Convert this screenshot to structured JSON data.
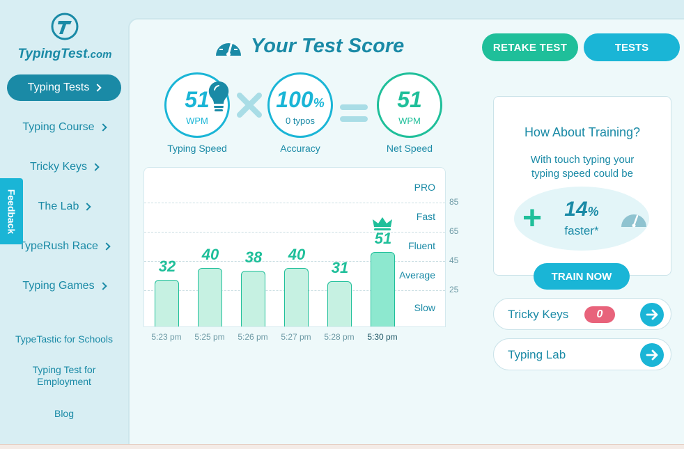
{
  "brand": {
    "name": "TypingTest",
    "suffix": ".com"
  },
  "sidebar": {
    "items": [
      {
        "label": "Typing Tests",
        "active": true
      },
      {
        "label": "Typing Course"
      },
      {
        "label": "Tricky Keys"
      },
      {
        "label": "The Lab"
      },
      {
        "label": "TypeRush Race"
      },
      {
        "label": "Typing Games"
      }
    ],
    "small_links": [
      {
        "label": "TypeTastic for Schools"
      },
      {
        "label": "Typing Test for Employment"
      },
      {
        "label": "Blog"
      }
    ],
    "feedback": "Feedback"
  },
  "header": {
    "title": "Your Test Score",
    "retake": "RETAKE TEST",
    "tests": "TESTS"
  },
  "score": {
    "speed": {
      "value": "51",
      "unit": "WPM",
      "label": "Typing Speed"
    },
    "accuracy": {
      "value": "100",
      "unit_pct": "%",
      "sub": "0  typos",
      "label": "Accuracy"
    },
    "net": {
      "value": "51",
      "unit": "WPM",
      "label": "Net Speed"
    }
  },
  "chart_data": {
    "type": "bar",
    "categories": [
      "5:23 pm",
      "5:25 pm",
      "5:26 pm",
      "5:27 pm",
      "5:28 pm",
      "5:30 pm"
    ],
    "values": [
      32,
      40,
      38,
      40,
      31,
      51
    ],
    "highlight_index": 5,
    "y_ticks": [
      25,
      45,
      65,
      85
    ],
    "tiers": [
      "PRO",
      "Fast",
      "Fluent",
      "Average",
      "Slow"
    ],
    "colors": {
      "bar": "#c6f1e2",
      "highlight": "#8de8cf",
      "border": "#1fbf9a"
    }
  },
  "training": {
    "title": "How About Training?",
    "text_line1": "With touch typing your",
    "text_line2": "typing speed could be",
    "plus": "+",
    "percent": "14",
    "percent_sign": "%",
    "faster": "faster*",
    "button": "TRAIN NOW"
  },
  "links": [
    {
      "label": "Tricky Keys",
      "badge": "0"
    },
    {
      "label": "Typing Lab"
    }
  ],
  "colors": {
    "primary": "#1a8aa6",
    "accent": "#1ab5d6",
    "green": "#1fbf9a",
    "badge": "#e8637b"
  }
}
